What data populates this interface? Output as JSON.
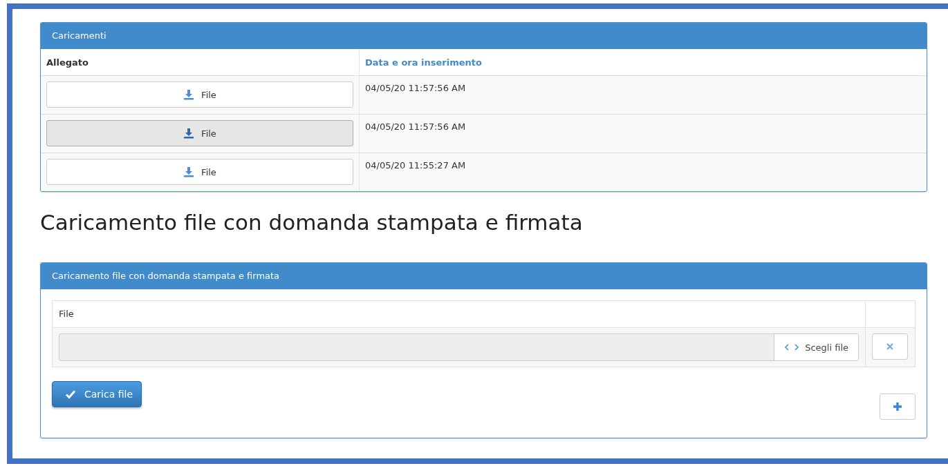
{
  "uploads_panel": {
    "title": "Caricamenti",
    "columns": [
      {
        "label": "Allegato",
        "kind": "plain"
      },
      {
        "label": "Data e ora inserimento",
        "kind": "link"
      }
    ],
    "rows": [
      {
        "button": "File",
        "pressed": false,
        "date": "04/05/20 11:57:56 AM"
      },
      {
        "button": "File",
        "pressed": true,
        "date": "04/05/20 11:57:56 AM"
      },
      {
        "button": "File",
        "pressed": false,
        "date": "04/05/20 11:55:27 AM"
      }
    ]
  },
  "heading": "Caricamento file con domanda stampata e firmata",
  "upload_panel": {
    "title": "Caricamento file con domanda stampata e firmata",
    "column": "File",
    "choose_button": "Scegli file",
    "submit_button": "Carica file"
  }
}
